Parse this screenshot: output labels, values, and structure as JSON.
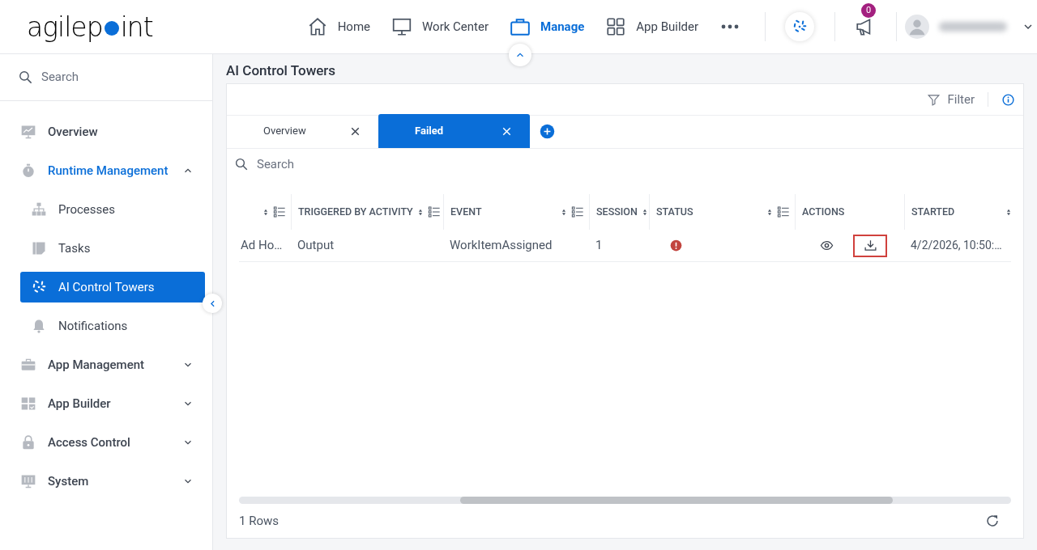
{
  "logo": {
    "before": "agilep",
    "after": "int"
  },
  "nav": [
    {
      "label": "Home",
      "selected": false
    },
    {
      "label": "Work Center",
      "selected": false
    },
    {
      "label": "Manage",
      "selected": true
    },
    {
      "label": "App Builder",
      "selected": false
    }
  ],
  "notification_count": "0",
  "sidebar": {
    "search": {
      "placeholder": "Search"
    },
    "items": [
      {
        "label": "Overview",
        "selected": false
      },
      {
        "label": "Runtime Management",
        "selected": false,
        "expanded": true,
        "children": [
          {
            "label": "Processes",
            "selected": false
          },
          {
            "label": "Tasks",
            "selected": false
          },
          {
            "label": "AI Control Towers",
            "selected": true
          },
          {
            "label": "Notifications",
            "selected": false
          }
        ]
      },
      {
        "label": "App Management",
        "selected": false,
        "expanded": false
      },
      {
        "label": "App Builder",
        "selected": false,
        "expanded": false
      },
      {
        "label": "Access Control",
        "selected": false,
        "expanded": false
      },
      {
        "label": "System",
        "selected": false,
        "expanded": false
      }
    ]
  },
  "page_title": "AI Control Towers",
  "toolbar": {
    "filter": "Filter"
  },
  "tabs": [
    {
      "label": "Overview",
      "selected": false
    },
    {
      "label": "Failed",
      "selected": true
    }
  ],
  "search": {
    "placeholder": "Search"
  },
  "table": {
    "columns": [
      {
        "sortable": true,
        "filterable": true
      },
      {
        "label": "TRIGGERED BY ACTIVITY",
        "sortable": true,
        "filterable": true
      },
      {
        "label": "EVENT",
        "sortable": true,
        "filterable": true
      },
      {
        "label": "SESSION",
        "sortable": true,
        "filterable": false
      },
      {
        "label": "STATUS",
        "sortable": true,
        "filterable": true
      },
      {
        "label": "ACTIONS",
        "sortable": false,
        "filterable": false
      },
      {
        "label": "STARTED",
        "sortable": true,
        "filterable": false
      }
    ],
    "rows": [
      {
        "cells": [
          "Ad Ho…",
          "Output",
          "WorkItemAssigned",
          "1"
        ],
        "error": true,
        "actions": [
          {
            "kind": "view",
            "highlighted": false
          },
          {
            "kind": "download",
            "highlighted": true
          }
        ],
        "started": "4/2/2026, 10:50:…"
      }
    ]
  },
  "row_count": "1 Rows"
}
